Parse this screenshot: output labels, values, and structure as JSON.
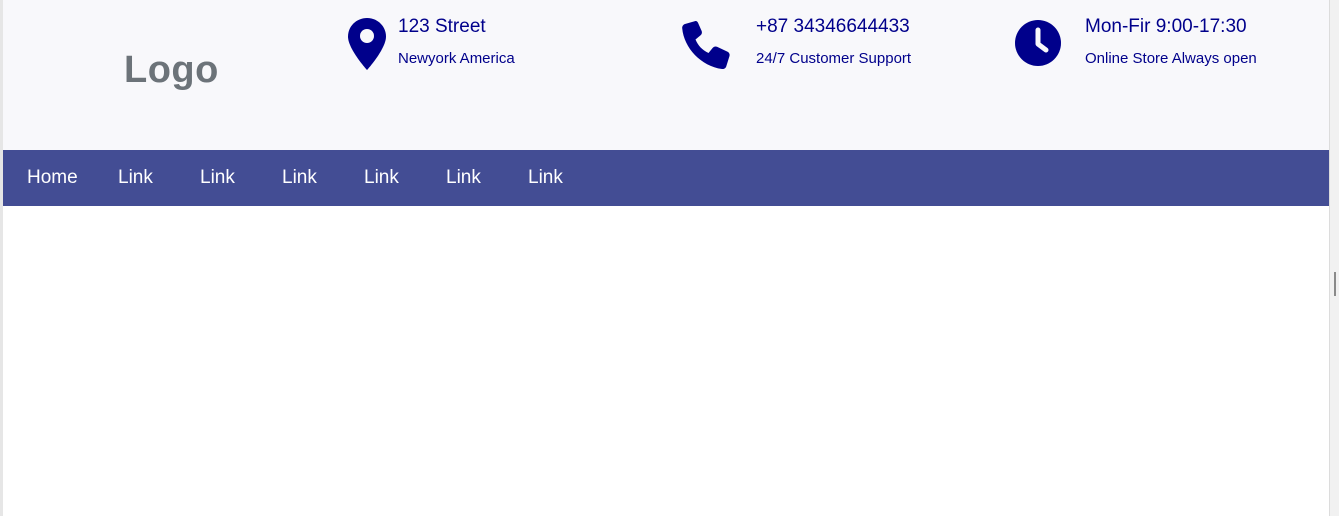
{
  "header": {
    "logo": "Logo",
    "address": {
      "icon": "map-marker-icon",
      "title": "123 Street",
      "subtitle": "Newyork America"
    },
    "phone": {
      "icon": "phone-icon",
      "title": "+87 34346644433",
      "subtitle": "24/7 Customer Support"
    },
    "hours": {
      "icon": "clock-icon",
      "title": "Mon-Fir 9:00-17:30",
      "subtitle": "Online Store Always open"
    }
  },
  "nav": {
    "items": [
      "Home",
      "Link",
      "Link",
      "Link",
      "Link",
      "Link",
      "Link"
    ]
  },
  "colors": {
    "accent": "#00008b",
    "navbar": "#434d94",
    "topbar": "#f8f8fb",
    "logo": "#6c7379"
  }
}
